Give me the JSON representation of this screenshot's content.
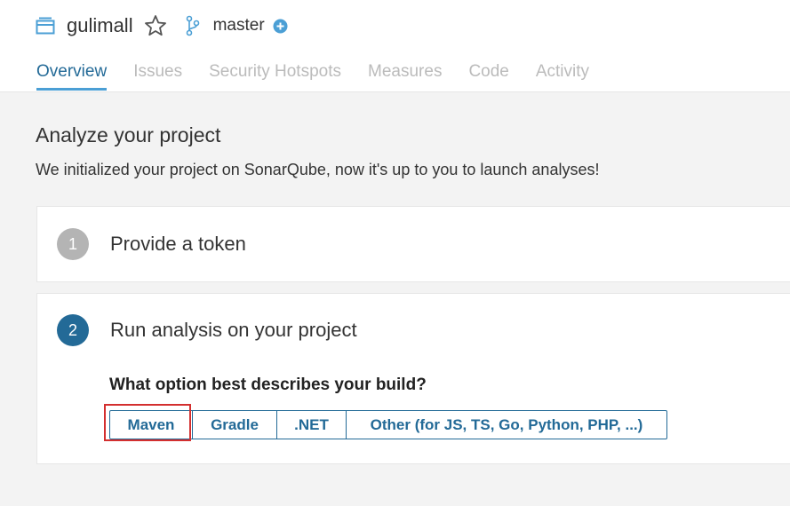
{
  "project": {
    "name": "gulimall"
  },
  "branch": {
    "name": "master"
  },
  "tabs": [
    {
      "label": "Overview",
      "active": true
    },
    {
      "label": "Issues"
    },
    {
      "label": "Security Hotspots"
    },
    {
      "label": "Measures"
    },
    {
      "label": "Code"
    },
    {
      "label": "Activity"
    }
  ],
  "main": {
    "title": "Analyze your project",
    "subtitle": "We initialized your project on SonarQube, now it's up to you to launch analyses!"
  },
  "steps": [
    {
      "number": "1",
      "title": "Provide a token"
    },
    {
      "number": "2",
      "title": "Run analysis on your project"
    }
  ],
  "build": {
    "question": "What option best describes your build?",
    "options": [
      "Maven",
      "Gradle",
      ".NET",
      "Other (for JS, TS, Go, Python, PHP, ...)"
    ]
  },
  "colors": {
    "accent": "#236a97",
    "tab_underline": "#4b9fd5",
    "step_inactive": "#b4b4b4",
    "highlight": "#d32f2f"
  },
  "icons": [
    "project-icon",
    "star-icon",
    "branch-icon",
    "plus-circle-icon"
  ]
}
